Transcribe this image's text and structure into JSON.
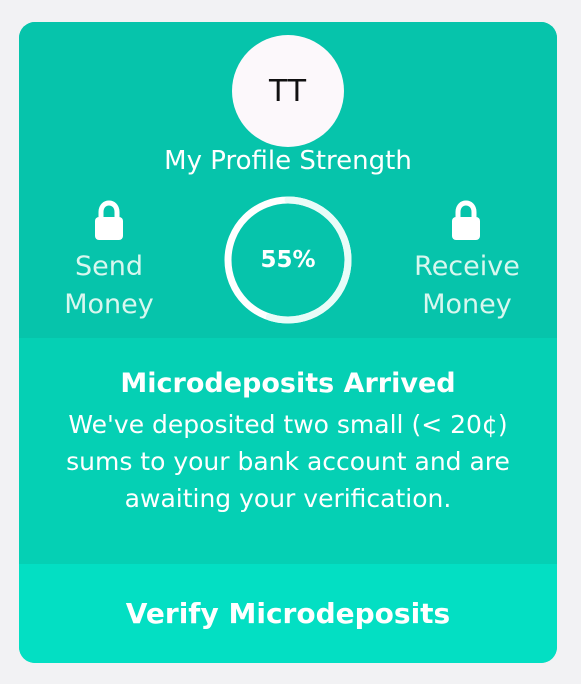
{
  "profile": {
    "initials": "TT",
    "title": "My Profile Strength",
    "progress_percent": 55,
    "progress_label": "55%"
  },
  "features": {
    "left": {
      "icon": "lock-icon",
      "line1": "Send",
      "line2": "Money"
    },
    "right": {
      "icon": "lock-icon",
      "line1": "Receive",
      "line2": "Money"
    }
  },
  "message": {
    "title": "Microdeposits Arrived",
    "line1": "We've deposited two small (< 20¢)",
    "line2": "sums to your bank account and are",
    "line3": "awaiting your verification."
  },
  "action": {
    "label": "Verify Microdeposits"
  },
  "colors": {
    "page_bg": "#f2f2f4",
    "card_primary": "#06c4ab",
    "card_secondary": "#05d0b4",
    "action_bg": "#03dfc3",
    "progress_track": "#ffffff",
    "avatar_bg": "#fcf8fb",
    "text": "#ffffff"
  }
}
